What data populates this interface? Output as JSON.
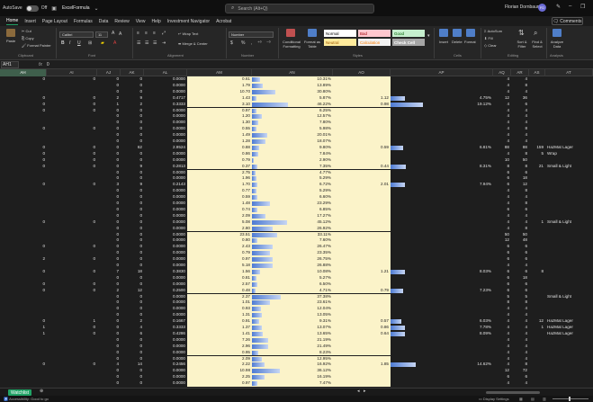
{
  "titlebar": {
    "autosave_label": "AutoSave",
    "autosave_state": "Off",
    "filename": "ExcelFormula",
    "search_placeholder": "Search (Alt+Q)",
    "user_name": "Florian Dornbaum",
    "user_initials": "FD"
  },
  "menu": [
    "Home",
    "Insert",
    "Page Layout",
    "Formulas",
    "Data",
    "Review",
    "View",
    "Help",
    "Investment Navigator",
    "Acrobat"
  ],
  "comments_label": "Comments",
  "ribbon": {
    "paste": "Paste",
    "cut": "Cut",
    "copy": "Copy",
    "format_painter": "Format Painter",
    "font_name": "Calibri",
    "font_size": "11",
    "wrap_text": "Wrap Text",
    "merge_center": "Merge & Center",
    "number_format": "Number",
    "conditional_formatting": "Conditional Formatting",
    "format_as_table": "Format as Table",
    "styles": {
      "normal": "Normal",
      "bad": "Bad",
      "good": "Good",
      "neutral": "Neutral",
      "calculation": "Calculation",
      "check_cell": "Check Cell"
    },
    "insert": "Insert",
    "delete": "Delete",
    "format": "Format",
    "autosum": "AutoSum",
    "fill": "Fill",
    "clear": "Clear",
    "sort_filter": "Sort & Filter",
    "find_select": "Find & Select",
    "analyze_data": "Analyze Data",
    "groups": {
      "clipboard": "Clipboard",
      "font": "Font",
      "alignment": "Alignment",
      "number": "Number",
      "styles": "Styles",
      "cells": "Cells",
      "editing": "Editing",
      "analysis": "Analysis"
    }
  },
  "formula_bar": {
    "name_box": "AH1",
    "fx": "fx",
    "value": "0"
  },
  "columns": [
    "AH",
    "AI",
    "AJ",
    "AK",
    "AL",
    "AM",
    "AN",
    "AO",
    "AP",
    "AQ",
    "AR",
    "AS",
    "AT"
  ],
  "rows": [
    {
      "ah": "0",
      "ai": "0",
      "aj": "0",
      "ak": "0",
      "al": "0.0000",
      "am": "0.61",
      "an": "10.31%",
      "ao": "",
      "ap": "",
      "aq": "4",
      "ar": "4",
      "as": "",
      "at": "",
      "an_bar": 0.103,
      "ap_bar": 0
    },
    {
      "ah": "",
      "ai": "",
      "aj": "0",
      "ak": "0",
      "al": "0.0000",
      "am": "1.79",
      "an": "13.89%",
      "ao": "",
      "ap": "",
      "aq": "4",
      "ar": "8",
      "as": "",
      "at": "",
      "an_bar": 0.139,
      "ap_bar": 0
    },
    {
      "ah": "",
      "ai": "",
      "aj": "0",
      "ak": "0",
      "al": "0.0000",
      "am": "10.70",
      "an": "30.80%",
      "ao": "",
      "ap": "",
      "aq": "4",
      "ar": "4",
      "as": "",
      "at": "",
      "an_bar": 0.308,
      "ap_bar": 0
    },
    {
      "ah": "0",
      "ai": "0",
      "aj": "2",
      "ak": "9",
      "al": "0.4717",
      "am": "1.43",
      "an": "5.87%",
      "ao": "1.12",
      "ap": "4.75%",
      "aq": "12",
      "ar": "36",
      "as": "",
      "at": "",
      "an_bar": 0.059,
      "ap_bar": 0.4
    },
    {
      "ah": "0",
      "ai": "0",
      "aj": "1",
      "ak": "2",
      "al": "0.3333",
      "am": "3.10",
      "an": "46.22%",
      "ao": "0.98",
      "ap": "19.12%",
      "aq": "4",
      "ar": "6",
      "as": "",
      "at": "",
      "an_bar": 0.462,
      "ap_bar": 0.9
    },
    {
      "ah": "0",
      "ai": "0",
      "aj": "0",
      "ak": "0",
      "al": "0.0000",
      "am": "0.97",
      "an": "6.25%",
      "ao": "",
      "ap": "",
      "aq": "4",
      "ar": "4",
      "as": "",
      "at": "",
      "an_bar": 0.063,
      "ap_bar": 0
    },
    {
      "ah": "",
      "ai": "",
      "aj": "0",
      "ak": "0",
      "al": "0.0000",
      "am": "1.20",
      "an": "12.57%",
      "ao": "",
      "ap": "",
      "aq": "4",
      "ar": "4",
      "as": "",
      "at": "",
      "an_bar": 0.126,
      "ap_bar": 0
    },
    {
      "ah": "",
      "ai": "",
      "aj": "0",
      "ak": "0",
      "al": "0.0000",
      "am": "1.30",
      "an": "7.80%",
      "ao": "",
      "ap": "",
      "aq": "4",
      "ar": "4",
      "as": "",
      "at": "",
      "an_bar": 0.078,
      "ap_bar": 0
    },
    {
      "ah": "0",
      "ai": "0",
      "aj": "0",
      "ak": "0",
      "al": "0.0000",
      "am": "0.55",
      "an": "5.98%",
      "ao": "",
      "ap": "",
      "aq": "4",
      "ar": "8",
      "as": "",
      "at": "",
      "an_bar": 0.06,
      "ap_bar": 0
    },
    {
      "ah": "",
      "ai": "",
      "aj": "0",
      "ak": "0",
      "al": "0.0000",
      "am": "1.49",
      "an": "20.01%",
      "ao": "",
      "ap": "",
      "aq": "4",
      "ar": "4",
      "as": "",
      "at": "",
      "an_bar": 0.2,
      "ap_bar": 0
    },
    {
      "ah": "",
      "ai": "",
      "aj": "0",
      "ak": "0",
      "al": "0.0000",
      "am": "1.28",
      "an": "18.07%",
      "ao": "",
      "ap": "",
      "aq": "4",
      "ar": "4",
      "as": "",
      "at": "",
      "an_bar": 0.181,
      "ap_bar": 0
    },
    {
      "ah": "0",
      "ai": "0",
      "aj": "0",
      "ak": "62",
      "al": "2.9524",
      "am": "0.88",
      "an": "9.80%",
      "ao": "0.59",
      "ap": "6.81%",
      "aq": "88",
      "ar": "88",
      "as": "159",
      "at": "HazMat Lager",
      "an_bar": 0.098,
      "ap_bar": 0.35
    },
    {
      "ah": "0",
      "ai": "0",
      "aj": "0",
      "ak": "0",
      "al": "0.0000",
      "am": "0.86",
      "an": "7.84%",
      "ao": "",
      "ap": "",
      "aq": "4",
      "ar": "8",
      "as": "5",
      "at": "Wrap",
      "an_bar": 0.078,
      "ap_bar": 0
    },
    {
      "ah": "0",
      "ai": "0",
      "aj": "0",
      "ak": "0",
      "al": "0.0000",
      "am": "0.79",
      "an": "2.90%",
      "ao": "",
      "ap": "",
      "aq": "10",
      "ar": "50",
      "as": "",
      "at": "",
      "an_bar": 0.029,
      "ap_bar": 0
    },
    {
      "ah": "0",
      "ai": "0",
      "aj": "0",
      "ak": "9",
      "al": "0.2813",
      "am": "0.37",
      "an": "7.35%",
      "ao": "0.44",
      "ap": "8.31%",
      "aq": "8",
      "ar": "8",
      "as": "21",
      "at": "Small & Light",
      "an_bar": 0.074,
      "ap_bar": 0.42
    },
    {
      "ah": "",
      "ai": "",
      "aj": "0",
      "ak": "0",
      "al": "0.0000",
      "am": "2.75",
      "an": "4.77%",
      "ao": "",
      "ap": "",
      "aq": "6",
      "ar": "6",
      "as": "",
      "at": "",
      "an_bar": 0.048,
      "ap_bar": 0
    },
    {
      "ah": "",
      "ai": "",
      "aj": "0",
      "ak": "0",
      "al": "0.0000",
      "am": "1.96",
      "an": "5.29%",
      "ao": "",
      "ap": "",
      "aq": "6",
      "ar": "18",
      "as": "",
      "at": "",
      "an_bar": 0.053,
      "ap_bar": 0
    },
    {
      "ah": "0",
      "ai": "0",
      "aj": "3",
      "ak": "9",
      "al": "0.2143",
      "am": "1.70",
      "an": "6.72%",
      "ao": "2.01",
      "ap": "7.94%",
      "aq": "6",
      "ar": "12",
      "as": "",
      "at": "",
      "an_bar": 0.067,
      "ap_bar": 0.4
    },
    {
      "ah": "",
      "ai": "",
      "aj": "0",
      "ak": "0",
      "al": "0.0000",
      "am": "0.77",
      "an": "5.29%",
      "ao": "",
      "ap": "",
      "aq": "4",
      "ar": "8",
      "as": "",
      "at": "",
      "an_bar": 0.053,
      "ap_bar": 0
    },
    {
      "ah": "",
      "ai": "",
      "aj": "0",
      "ak": "0",
      "al": "0.0000",
      "am": "0.59",
      "an": "6.60%",
      "ao": "",
      "ap": "",
      "aq": "4",
      "ar": "4",
      "as": "",
      "at": "",
      "an_bar": 0.066,
      "ap_bar": 0
    },
    {
      "ah": "",
      "ai": "",
      "aj": "0",
      "ak": "0",
      "al": "0.0000",
      "am": "1.48",
      "an": "23.29%",
      "ao": "",
      "ap": "",
      "aq": "4",
      "ar": "8",
      "as": "",
      "at": "",
      "an_bar": 0.233,
      "ap_bar": 0
    },
    {
      "ah": "",
      "ai": "",
      "aj": "0",
      "ak": "0",
      "al": "0.0000",
      "am": "0.74",
      "an": "6.85%",
      "ao": "",
      "ap": "",
      "aq": "6",
      "ar": "6",
      "as": "",
      "at": "",
      "an_bar": 0.069,
      "ap_bar": 0
    },
    {
      "ah": "",
      "ai": "",
      "aj": "0",
      "ak": "0",
      "al": "0.0000",
      "am": "2.09",
      "an": "17.27%",
      "ao": "",
      "ap": "",
      "aq": "4",
      "ar": "4",
      "as": "",
      "at": "",
      "an_bar": 0.173,
      "ap_bar": 0
    },
    {
      "ah": "0",
      "ai": "0",
      "aj": "0",
      "ak": "0",
      "al": "0.0000",
      "am": "5.08",
      "an": "45.12%",
      "ao": "",
      "ap": "",
      "aq": "4",
      "ar": "4",
      "as": "1",
      "at": "Small & Light",
      "an_bar": 0.451,
      "ap_bar": 0
    },
    {
      "ah": "",
      "ai": "",
      "aj": "0",
      "ak": "0",
      "al": "0.0000",
      "am": "2.80",
      "an": "26.92%",
      "ao": "",
      "ap": "",
      "aq": "4",
      "ar": "8",
      "as": "",
      "at": "",
      "an_bar": 0.269,
      "ap_bar": 0
    },
    {
      "ah": "",
      "ai": "",
      "aj": "0",
      "ak": "0",
      "al": "0.0000",
      "am": "23.51",
      "an": "33.11%",
      "ao": "",
      "ap": "",
      "aq": "50",
      "ar": "50",
      "as": "",
      "at": "",
      "an_bar": 0.331,
      "ap_bar": 0
    },
    {
      "ah": "",
      "ai": "",
      "aj": "0",
      "ak": "0",
      "al": "0.0000",
      "am": "0.80",
      "an": "7.60%",
      "ao": "",
      "ap": "",
      "aq": "12",
      "ar": "48",
      "as": "",
      "at": "",
      "an_bar": 0.076,
      "ap_bar": 0
    },
    {
      "ah": "0",
      "ai": "0",
      "aj": "0",
      "ak": "0",
      "al": "0.0000",
      "am": "2.43",
      "an": "26.47%",
      "ao": "",
      "ap": "",
      "aq": "6",
      "ar": "6",
      "as": "",
      "at": "",
      "an_bar": 0.265,
      "ap_bar": 0
    },
    {
      "ah": "",
      "ai": "",
      "aj": "0",
      "ak": "0",
      "al": "0.0000",
      "am": "0.79",
      "an": "23.35%",
      "ao": "",
      "ap": "",
      "aq": "6",
      "ar": "6",
      "as": "",
      "at": "",
      "an_bar": 0.234,
      "ap_bar": 0
    },
    {
      "ah": "2",
      "ai": "0",
      "aj": "0",
      "ak": "0",
      "al": "0.0000",
      "am": "0.97",
      "an": "26.75%",
      "ao": "",
      "ap": "",
      "aq": "6",
      "ar": "6",
      "as": "",
      "at": "",
      "an_bar": 0.268,
      "ap_bar": 0
    },
    {
      "ah": "",
      "ai": "",
      "aj": "0",
      "ak": "0",
      "al": "0.0000",
      "am": "5.18",
      "an": "26.88%",
      "ao": "",
      "ap": "",
      "aq": "4",
      "ar": "4",
      "as": "",
      "at": "",
      "an_bar": 0.269,
      "ap_bar": 0
    },
    {
      "ah": "0",
      "ai": "0",
      "aj": "7",
      "ak": "18",
      "al": "0.3830",
      "am": "1.56",
      "an": "10.08%",
      "ao": "1.21",
      "ap": "8.03%",
      "aq": "6",
      "ar": "6",
      "as": "8",
      "at": "",
      "an_bar": 0.101,
      "ap_bar": 0.4
    },
    {
      "ah": "",
      "ai": "",
      "aj": "0",
      "ak": "0",
      "al": "0.0000",
      "am": "0.81",
      "an": "5.27%",
      "ao": "",
      "ap": "",
      "aq": "6",
      "ar": "18",
      "as": "",
      "at": "",
      "an_bar": 0.053,
      "ap_bar": 0
    },
    {
      "ah": "0",
      "ai": "0",
      "aj": "0",
      "ak": "0",
      "al": "0.0000",
      "am": "2.57",
      "an": "6.50%",
      "ao": "",
      "ap": "",
      "aq": "6",
      "ar": "6",
      "as": "",
      "at": "",
      "an_bar": 0.065,
      "ap_bar": 0
    },
    {
      "ah": "0",
      "ai": "0",
      "aj": "2",
      "ak": "12",
      "al": "0.2500",
      "am": "0.48",
      "an": "4.71%",
      "ao": "0.79",
      "ap": "7.23%",
      "aq": "6",
      "ar": "6",
      "as": "",
      "at": "",
      "an_bar": 0.047,
      "ap_bar": 0.36
    },
    {
      "ah": "",
      "ai": "",
      "aj": "0",
      "ak": "0",
      "al": "0.0000",
      "am": "2.37",
      "an": "37.38%",
      "ao": "",
      "ap": "",
      "aq": "5",
      "ar": "5",
      "as": "",
      "at": "Small & Light",
      "an_bar": 0.374,
      "ap_bar": 0
    },
    {
      "ah": "",
      "ai": "",
      "aj": "0",
      "ak": "0",
      "al": "0.0000",
      "am": "1.01",
      "an": "23.61%",
      "ao": "",
      "ap": "",
      "aq": "8",
      "ar": "8",
      "as": "",
      "at": "",
      "an_bar": 0.236,
      "ap_bar": 0
    },
    {
      "ah": "",
      "ai": "",
      "aj": "0",
      "ak": "0",
      "al": "0.0000",
      "am": "0.93",
      "an": "12.04%",
      "ao": "",
      "ap": "",
      "aq": "4",
      "ar": "4",
      "as": "",
      "at": "",
      "an_bar": 0.12,
      "ap_bar": 0
    },
    {
      "ah": "",
      "ai": "",
      "aj": "0",
      "ak": "0",
      "al": "0.0000",
      "am": "1.31",
      "an": "13.05%",
      "ao": "",
      "ap": "",
      "aq": "4",
      "ar": "4",
      "as": "",
      "at": "",
      "an_bar": 0.131,
      "ap_bar": 0
    },
    {
      "ah": "0",
      "ai": "1",
      "aj": "0",
      "ak": "2",
      "al": "0.1667",
      "am": "0.91",
      "an": "9.31%",
      "ao": "0.57",
      "ap": "6.03%",
      "aq": "4",
      "ar": "4",
      "as": "12",
      "at": "HazMat Lager",
      "an_bar": 0.093,
      "ap_bar": 0.3
    },
    {
      "ah": "1",
      "ai": "0",
      "aj": "0",
      "ak": "4",
      "al": "0.3333",
      "am": "1.37",
      "an": "13.07%",
      "ao": "0.86",
      "ap": "7.78%",
      "aq": "4",
      "ar": "4",
      "as": "1",
      "at": "HazMat Lager",
      "an_bar": 0.131,
      "ap_bar": 0.39
    },
    {
      "ah": "1",
      "ai": "0",
      "aj": "0",
      "ak": "6",
      "al": "0.4286",
      "am": "1.41",
      "an": "13.65%",
      "ao": "0.64",
      "ap": "8.09%",
      "aq": "4",
      "ar": "4",
      "as": "",
      "at": "HazMat Lager",
      "an_bar": 0.137,
      "ap_bar": 0.4
    },
    {
      "ah": "",
      "ai": "",
      "aj": "0",
      "ak": "0",
      "al": "0.0000",
      "am": "7.26",
      "an": "21.19%",
      "ao": "",
      "ap": "",
      "aq": "4",
      "ar": "4",
      "as": "",
      "at": "",
      "an_bar": 0.212,
      "ap_bar": 0
    },
    {
      "ah": "",
      "ai": "",
      "aj": "0",
      "ak": "0",
      "al": "0.0000",
      "am": "2.96",
      "an": "21.49%",
      "ao": "",
      "ap": "",
      "aq": "4",
      "ar": "4",
      "as": "",
      "at": "",
      "an_bar": 0.215,
      "ap_bar": 0
    },
    {
      "ah": "",
      "ai": "",
      "aj": "0",
      "ak": "0",
      "al": "0.0000",
      "am": "0.95",
      "an": "8.23%",
      "ao": "",
      "ap": "",
      "aq": "4",
      "ar": "4",
      "as": "",
      "at": "",
      "an_bar": 0.082,
      "ap_bar": 0
    },
    {
      "ah": "",
      "ai": "",
      "aj": "0",
      "ak": "0",
      "al": "0.0000",
      "am": "2.09",
      "an": "12.95%",
      "ao": "",
      "ap": "",
      "aq": "4",
      "ar": "4",
      "as": "",
      "at": "",
      "an_bar": 0.13,
      "ap_bar": 0
    },
    {
      "ah": "0",
      "ai": "0",
      "aj": "4",
      "ak": "14",
      "al": "0.2456",
      "am": "2.22",
      "an": "16.92%",
      "ao": "1.85",
      "ap": "14.62%",
      "aq": "4",
      "ar": "8",
      "as": "",
      "at": "",
      "an_bar": 0.169,
      "ap_bar": 0.7
    },
    {
      "ah": "",
      "ai": "",
      "aj": "0",
      "ak": "0",
      "al": "0.0000",
      "am": "10.98",
      "an": "36.12%",
      "ao": "",
      "ap": "",
      "aq": "12",
      "ar": "72",
      "as": "",
      "at": "",
      "an_bar": 0.361,
      "ap_bar": 0
    },
    {
      "ah": "",
      "ai": "",
      "aj": "0",
      "ak": "0",
      "al": "0.0000",
      "am": "2.25",
      "an": "16.19%",
      "ao": "",
      "ap": "",
      "aq": "6",
      "ar": "6",
      "as": "",
      "at": "",
      "an_bar": 0.162,
      "ap_bar": 0
    },
    {
      "ah": "",
      "ai": "",
      "aj": "0",
      "ak": "0",
      "al": "0.0000",
      "am": "0.97",
      "an": "7.47%",
      "ao": "",
      "ap": "",
      "aq": "4",
      "ar": "4",
      "as": "",
      "at": "",
      "an_bar": 0.075,
      "ap_bar": 0
    }
  ],
  "sheet_tab": "Watchlist",
  "status": {
    "accessibility": "Accessibility: Good to go",
    "display_settings": "Display Settings"
  },
  "colors": {
    "accent": "#21a366",
    "yellow_fill": "#fbf3c9",
    "bar_blue": "#4e7bd3"
  }
}
